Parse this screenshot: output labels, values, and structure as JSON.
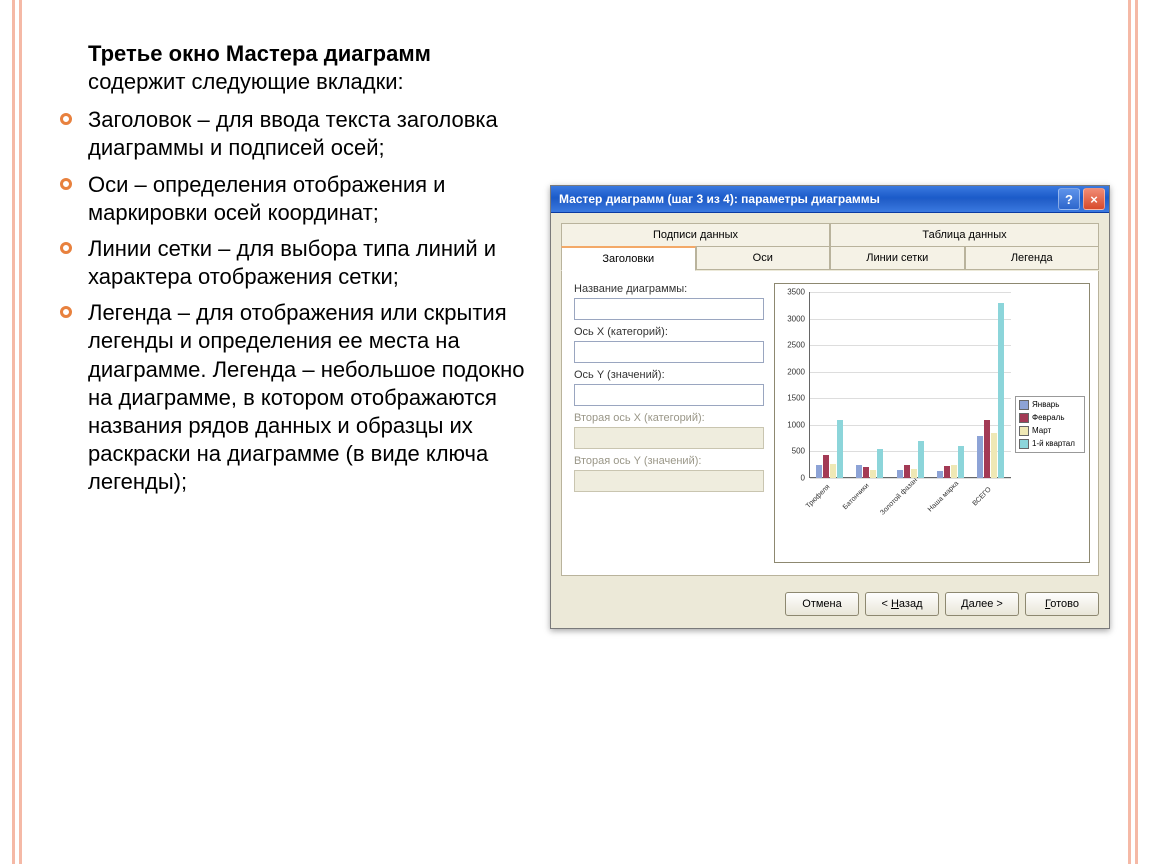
{
  "lead_bold": "Третье окно Мастера диаграмм",
  "lead_rest": " содержит следующие вкладки:",
  "bullets": [
    "Заголовок – для ввода текста заголовка диаграммы и подписей осей;",
    "Оси – определения отображения и маркировки осей координат;",
    "Линии сетки – для выбора типа линий и характера отображения сетки;",
    "Легенда – для отображения или скрытия легенды и определения ее места на диаграмме. Легенда – небольшое подокно на диаграмме, в котором отображаются названия рядов данных и образцы их раскраски на диаграмме (в виде ключа легенды);"
  ],
  "dialog": {
    "title": "Мастер диаграмм (шаг 3 из 4): параметры диаграммы",
    "tabs_top": [
      "Подписи данных",
      "Таблица данных"
    ],
    "tabs_bottom": [
      "Заголовки",
      "Оси",
      "Линии сетки",
      "Легенда"
    ],
    "active_tab": "Заголовки",
    "fields": {
      "chart_title_label": "Название диаграммы:",
      "axis_x_label": "Ось X (категорий):",
      "axis_y_label": "Ось Y (значений):",
      "axis_x2_label": "Вторая ось X (категорий):",
      "axis_y2_label": "Вторая ось Y (значений):"
    },
    "buttons": {
      "cancel": "Отмена",
      "back": "< Назад",
      "next": "Далее >",
      "finish": "Готово"
    }
  },
  "chart_data": {
    "type": "bar",
    "categories": [
      "Трюфеля",
      "Батончики",
      "Золотой фазан",
      "Наша марка",
      "ВСЕГО"
    ],
    "series": [
      {
        "name": "Январь",
        "color": "#8da3d6",
        "values": [
          250,
          250,
          150,
          140,
          790
        ]
      },
      {
        "name": "Февраль",
        "color": "#a33a55",
        "values": [
          430,
          200,
          250,
          220,
          1100
        ]
      },
      {
        "name": "Март",
        "color": "#efe8b5",
        "values": [
          270,
          160,
          170,
          250,
          850
        ]
      },
      {
        "name": "1-й квартал",
        "color": "#8cd5da",
        "values": [
          1100,
          550,
          700,
          610,
          3300
        ]
      }
    ],
    "ylim": [
      0,
      3500
    ],
    "yticks": [
      0,
      500,
      1000,
      1500,
      2000,
      2500,
      3000,
      3500
    ]
  }
}
